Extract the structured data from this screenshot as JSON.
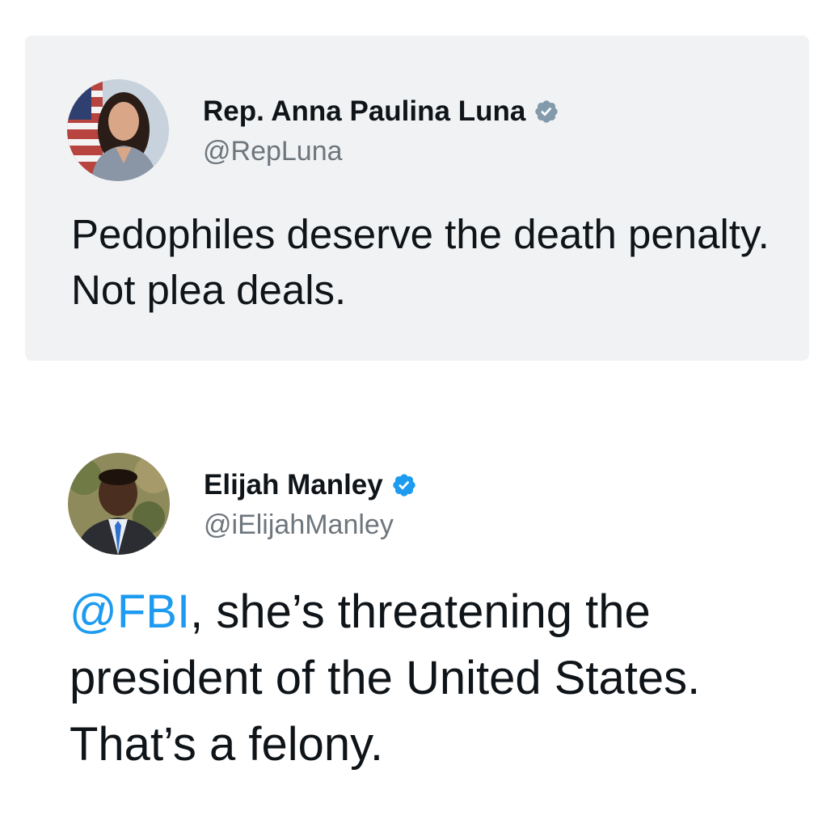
{
  "quoted_tweet": {
    "author": {
      "name": "Rep. Anna Paulina Luna",
      "handle": "@RepLuna",
      "verified_badge_color": "#829aab",
      "avatar_icon": "profile-photo"
    },
    "text": "Pedophiles deserve the death penalty. Not plea deals."
  },
  "reply_tweet": {
    "author": {
      "name": "Elijah Manley",
      "handle": "@iElijahManley",
      "verified_badge_color": "#1d9bf0",
      "avatar_icon": "profile-photo"
    },
    "text": {
      "mention": "@FBI",
      "rest": ", she’s threatening the president of the United States. That’s a felony."
    }
  },
  "colors": {
    "card_background": "#f1f2f3",
    "text": "#0f1419",
    "handle": "#6e767d",
    "link": "#1d9bf0"
  }
}
